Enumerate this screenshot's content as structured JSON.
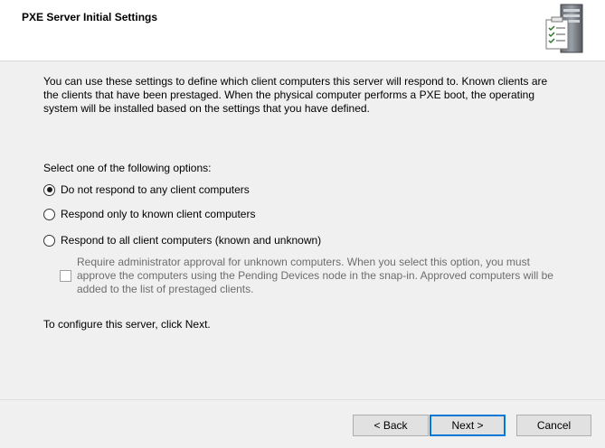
{
  "header": {
    "title": "PXE Server Initial Settings",
    "icon": "server-checklist-icon"
  },
  "intro": {
    "line1": "You can use these settings to define which client computers this server will respond to. Known clients are",
    "line2": "the clients that have been prestaged. When the physical computer performs a PXE boot, the operating",
    "line3": "system will be installed based on the settings that you have defined."
  },
  "options": {
    "label": "Select one of the following options:",
    "items": [
      {
        "label": "Do not respond to any client computers",
        "checked": true
      },
      {
        "label": "Respond only to known client computers",
        "checked": false
      },
      {
        "label": "Respond to all client computers (known and unknown)",
        "checked": false
      }
    ],
    "approval": {
      "line1": "Require administrator approval for unknown computers. When you select this option, you must",
      "line2": "approve the computers using the Pending Devices node in the snap-in. Approved computers will be",
      "line3": "added to the list of prestaged clients.",
      "checked": false,
      "enabled": false
    }
  },
  "footer": {
    "note": "To configure this server, click Next."
  },
  "buttons": {
    "back": "< Back",
    "next": "Next >",
    "cancel": "Cancel"
  },
  "colors": {
    "accent": "#0078d7",
    "dialog_bg": "#f0f0f0",
    "header_bg": "#ffffff"
  }
}
